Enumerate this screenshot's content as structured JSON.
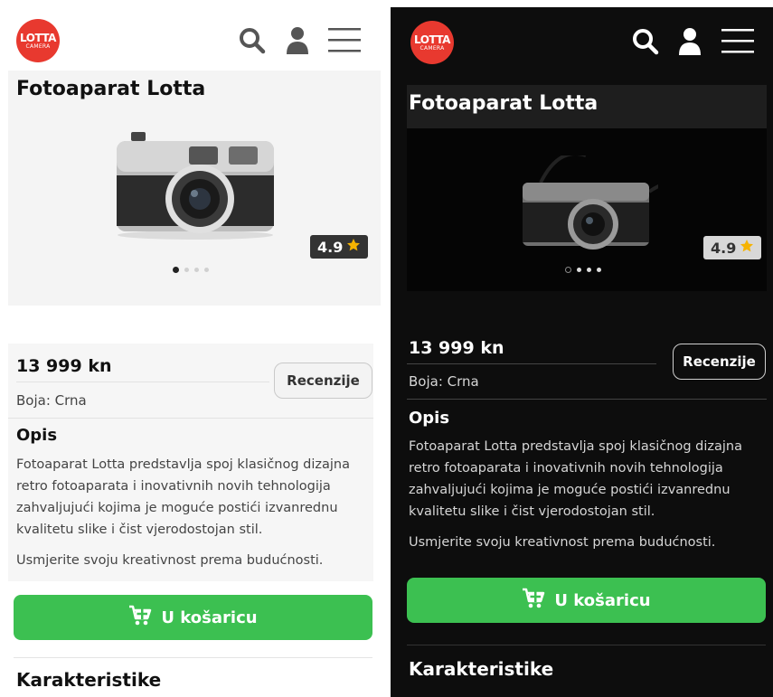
{
  "logo": {
    "line1": "LOTTA",
    "line2": "CAMERA",
    "color": "#e8392f"
  },
  "header": {
    "icons": [
      "search-icon",
      "user-icon",
      "menu-icon"
    ]
  },
  "product": {
    "title": "Fotoaparat Lotta",
    "rating": "4.9",
    "price": "13 999 kn",
    "color_label": "Boja: Crna",
    "review_button": "Recenzije",
    "description_heading": "Opis",
    "description": "Fotoaparat Lotta predstavlja spoj klasičnog dizajna retro fotoaparata i inovativnih novih tehnologija zahvaljujući kojima je moguće postići izvanrednu kvalitetu slike i čist vjerodostojan stil.",
    "description_extra": "Usmjerite svoju kreativnost prema budućnosti.",
    "cart_button": "U košaricu",
    "characteristics_heading": "Karakteristike"
  },
  "colors": {
    "accent_green": "#3cc051",
    "star": "#f5b301",
    "dark_bg": "#0d0d0d",
    "light_bg": "#ffffff"
  }
}
